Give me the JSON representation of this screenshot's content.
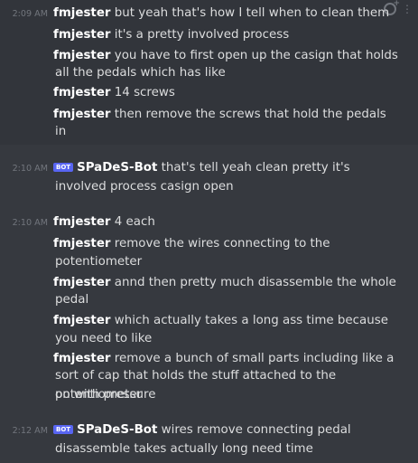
{
  "messages": [
    {
      "time": "2:09 AM",
      "author": "fmjester",
      "lines": [
        "but yeah that's how I tell when to clean them"
      ]
    },
    {
      "author": "fmjester",
      "lines": [
        "it's a pretty involved process"
      ]
    },
    {
      "author": "fmjester",
      "lines": [
        "you have to first open up the casign that holds",
        "all the pedals which has like"
      ]
    },
    {
      "author": "fmjester",
      "lines": [
        "14 screws"
      ]
    },
    {
      "author": "fmjester",
      "lines": [
        "then remove the screws that hold the pedals",
        "in"
      ]
    },
    {
      "time": "2:10 AM",
      "bot": "BOT",
      "author": "SPaDeS-Bot",
      "lines": [
        "that's tell yeah clean pretty it's",
        "involved process casign open"
      ]
    },
    {
      "time": "2:10 AM",
      "author": "fmjester",
      "lines": [
        "4 each"
      ]
    },
    {
      "author": "fmjester",
      "lines": [
        "remove the wires connecting to the",
        "potentiometer"
      ]
    },
    {
      "author": "fmjester",
      "lines": [
        "annd then pretty much disassemble the whole",
        "pedal"
      ]
    },
    {
      "author": "fmjester",
      "lines": [
        "which actually takes a long ass time because",
        "you need to like"
      ]
    },
    {
      "author": "fmjester",
      "lines": [
        "remove a bunch of small parts including like a",
        "sort of cap that holds the stuff attached to the potentiometer",
        "on with pressure"
      ]
    },
    {
      "time": "2:12 AM",
      "bot": "BOT",
      "author": "SPaDeS-Bot",
      "lines": [
        "wires remove connecting pedal",
        "disassemble takes actually long need time"
      ]
    }
  ]
}
